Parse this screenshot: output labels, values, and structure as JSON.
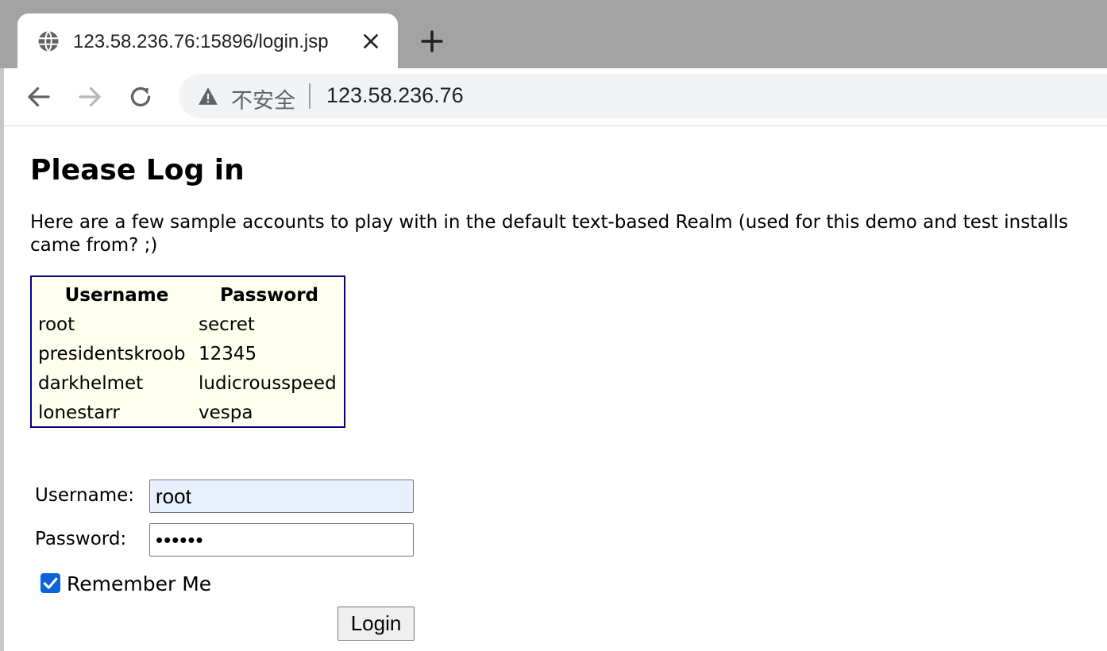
{
  "browser": {
    "tab_title": "123.58.236.76:15896/login.jsp",
    "security_label": "不安全",
    "url": "123.58.236.76",
    "icons": {
      "tab": "globe-icon",
      "close": "close-icon",
      "new_tab": "plus-icon",
      "back": "back-arrow-icon",
      "forward": "forward-arrow-icon",
      "reload": "reload-icon",
      "security": "warning-icon"
    }
  },
  "page": {
    "title": "Please Log in",
    "intro_line1": "Here are a few sample accounts to play with in the default text-based Realm (used for this demo and test installs",
    "intro_line2": "came from? ;)",
    "accounts_table": {
      "headers": [
        "Username",
        "Password"
      ],
      "rows": [
        [
          "root",
          "secret"
        ],
        [
          "presidentskroob",
          "12345"
        ],
        [
          "darkhelmet",
          "ludicrousspeed"
        ],
        [
          "lonestarr",
          "vespa"
        ]
      ]
    },
    "form": {
      "username_label": "Username:",
      "username_value": "root",
      "password_label": "Password:",
      "password_value": "••••••",
      "remember_label": "Remember Me",
      "remember_checked": true,
      "login_label": "Login"
    }
  },
  "colors": {
    "tabstrip": "#a3a3a3",
    "omnibox": "#f1f3f4",
    "table_border": "#00008b",
    "table_background": "#fffff0",
    "autofill_background": "#e8f0fe",
    "checkbox": "#0b63d8"
  }
}
